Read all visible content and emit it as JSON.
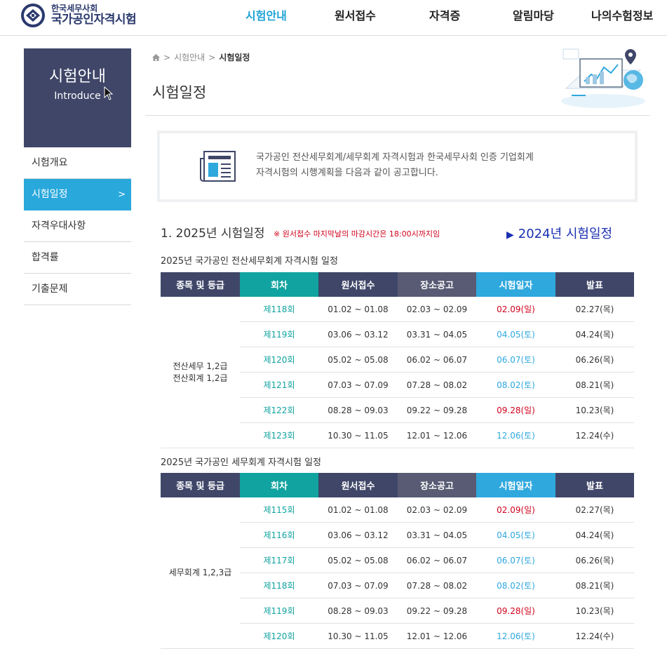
{
  "header": {
    "logo_sub": "한국세무사회",
    "logo_main": "국가공인자격시험",
    "nav": [
      "시험안내",
      "원서접수",
      "자격증",
      "알림마당",
      "나의수험정보"
    ]
  },
  "sidebar": {
    "title": "시험안내",
    "subtitle": "Introduce",
    "items": [
      {
        "label": "시험개요"
      },
      {
        "label": "시험일정",
        "arrow": ">"
      },
      {
        "label": "자격우대사항"
      },
      {
        "label": "합격률"
      },
      {
        "label": "기출문제"
      }
    ]
  },
  "breadcrumb": {
    "sep1": ">",
    "item1": "시험안내",
    "sep2": ">",
    "current": "시험일정"
  },
  "page_title": "시험일정",
  "notice": {
    "line1": "국가공인 전산세무회계/세무회계 자격시험과 한국세무사회 인증 기업회계",
    "line2": "자격시험의 시행계획을 다음과 같이 공고합니다."
  },
  "section": {
    "title": "1. 2025년 시험일정",
    "note": "※ 원서접수 마지막날의 마감시간은 18:00시까지임",
    "link_2024": "2024년 시험일정"
  },
  "tables": [
    {
      "title": "2025년 국가공인 전산세무회계 자격시험 일정",
      "headers": [
        "종목 및 등급",
        "회차",
        "원서접수",
        "장소공고",
        "시험일자",
        "발표"
      ],
      "grade_line1": "전산세무 1,2급",
      "grade_line2": "전산회계 1,2급",
      "rows": [
        {
          "round": "제118회",
          "apply": "01.02 ~ 01.08",
          "venue": "02.03 ~ 02.09",
          "exam": "02.09(일)",
          "result": "02.27(목)"
        },
        {
          "round": "제119회",
          "apply": "03.06 ~ 03.12",
          "venue": "03.31 ~ 04.05",
          "exam": "04.05(토)",
          "result": "04.24(목)"
        },
        {
          "round": "제120회",
          "apply": "05.02 ~ 05.08",
          "venue": "06.02 ~ 06.07",
          "exam": "06.07(토)",
          "result": "06.26(목)"
        },
        {
          "round": "제121회",
          "apply": "07.03 ~ 07.09",
          "venue": "07.28 ~ 08.02",
          "exam": "08.02(토)",
          "result": "08.21(목)"
        },
        {
          "round": "제122회",
          "apply": "08.28 ~ 09.03",
          "venue": "09.22 ~ 09.28",
          "exam": "09.28(일)",
          "result": "10.23(목)"
        },
        {
          "round": "제123회",
          "apply": "10.30 ~ 11.05",
          "venue": "12.01 ~ 12.06",
          "exam": "12.06(토)",
          "result": "12.24(수)"
        }
      ]
    },
    {
      "title": "2025년 국가공인 세무회계 자격시험 일정",
      "headers": [
        "종목 및 등급",
        "회차",
        "원서접수",
        "장소공고",
        "시험일자",
        "발표"
      ],
      "grade_line1": "세무회계 1,2,3급",
      "grade_line2": "",
      "rows": [
        {
          "round": "제115회",
          "apply": "01.02 ~ 01.08",
          "venue": "02.03 ~ 02.09",
          "exam": "02.09(일)",
          "result": "02.27(목)"
        },
        {
          "round": "제116회",
          "apply": "03.06 ~ 03.12",
          "venue": "03.31 ~ 04.05",
          "exam": "04.05(토)",
          "result": "04.24(목)"
        },
        {
          "round": "제117회",
          "apply": "05.02 ~ 05.08",
          "venue": "06.02 ~ 06.07",
          "exam": "06.07(토)",
          "result": "06.26(목)"
        },
        {
          "round": "제118회",
          "apply": "07.03 ~ 07.09",
          "venue": "07.28 ~ 08.02",
          "exam": "08.02(토)",
          "result": "08.21(목)"
        },
        {
          "round": "제119회",
          "apply": "08.28 ~ 09.03",
          "venue": "09.22 ~ 09.28",
          "exam": "09.28(일)",
          "result": "10.23(목)"
        },
        {
          "round": "제120회",
          "apply": "10.30 ~ 11.05",
          "venue": "12.01 ~ 12.06",
          "exam": "12.06(토)",
          "result": "12.24(수)"
        }
      ]
    }
  ],
  "colors": {
    "sunday": "#d0021b",
    "saturday": "#2fa8de",
    "accent": "#29a8dc",
    "navy": "#3f4668",
    "teal": "#10a3a0"
  }
}
